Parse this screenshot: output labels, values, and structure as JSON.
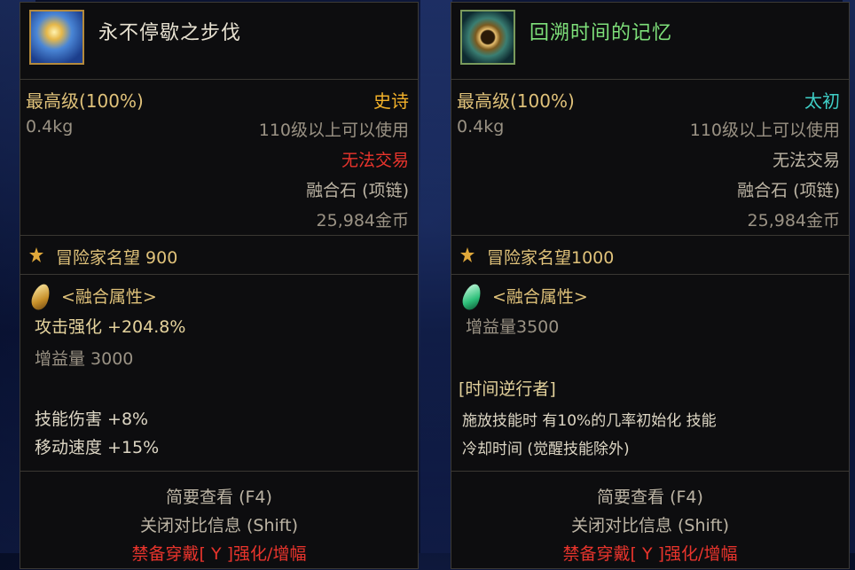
{
  "left": {
    "title": "永不停歇之步伐",
    "icon": "fusion-stone-blue-icon",
    "grade": "最高级(100%)",
    "rarity": "史诗",
    "weight": "0.4kg",
    "level_req": "110级以上可以使用",
    "trade": "无法交易",
    "type": "融合石 (项链)",
    "price": "25,984金币",
    "fame": "冒险家名望 900",
    "fusion_header": "<融合属性>",
    "stat1": "攻击强化 +204.8%",
    "stat2": "增益量 3000",
    "stat3": "技能伤害 +8%",
    "stat4": "移动速度 +15%",
    "footer1": "简要查看 (F4)",
    "footer2": "关闭对比信息 (Shift)",
    "footer3": "禁备穿戴[ Y ]强化/增幅"
  },
  "right": {
    "title": "回溯时间的记忆",
    "icon": "fusion-stone-clock-icon",
    "grade": "最高级(100%)",
    "rarity": "太初",
    "weight": "0.4kg",
    "level_req": "110级以上可以使用",
    "trade": "无法交易",
    "type": "融合石 (项链)",
    "price": "25,984金币",
    "fame": "冒险家名望1000",
    "fusion_header": "<融合属性>",
    "stat1": "增益量3500",
    "effect_title": "[时间逆行者]",
    "effect_line1": "施放技能时 有10%的几率初始化 技能",
    "effect_line2": "冷却时间 (觉醒技能除外)",
    "footer1": "简要查看 (F4)",
    "footer2": "关闭对比信息 (Shift)",
    "footer3": "禁备穿戴[ Y ]强化/增幅"
  },
  "colors": {
    "epic": "#f2b12a",
    "primeval": "#3fd0c8",
    "untradable": "#e8342c",
    "title_left": "#e8e2d2",
    "title_right": "#7ee07a"
  }
}
